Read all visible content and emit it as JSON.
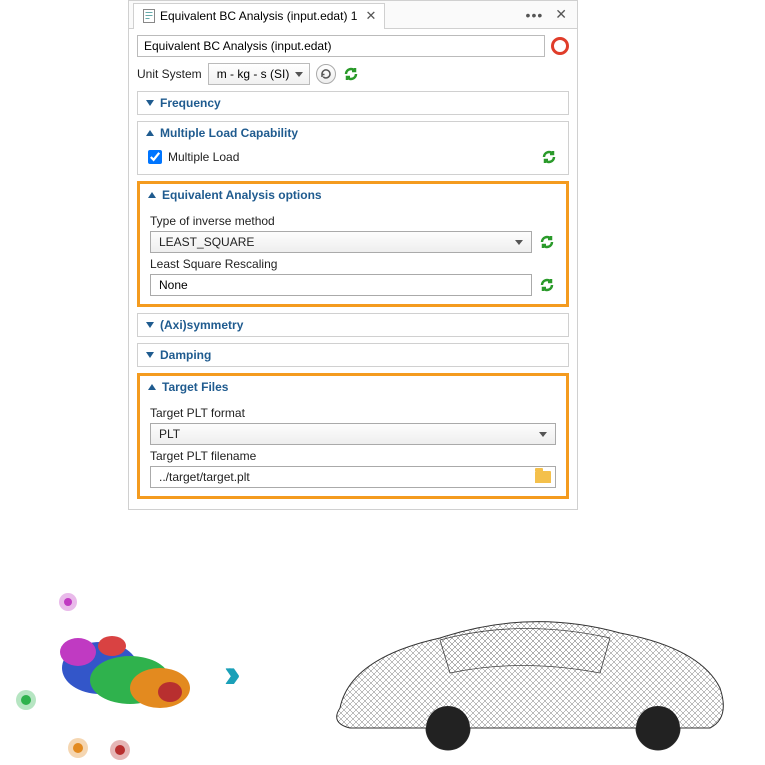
{
  "tab": {
    "title": "Equivalent BC Analysis (input.edat) 1"
  },
  "name_field": "Equivalent BC Analysis (input.edat)",
  "unit_system_label": "Unit System",
  "unit_system_value": "m - kg - s (SI)",
  "sections": {
    "frequency": {
      "title": "Frequency",
      "expanded": false
    },
    "multiple_load": {
      "title": "Multiple Load Capability",
      "expanded": true,
      "checkbox_label": "Multiple Load",
      "checked": true
    },
    "equiv_options": {
      "title": "Equivalent Analysis options",
      "expanded": true,
      "inverse_label": "Type of inverse method",
      "inverse_value": "LEAST_SQUARE",
      "rescale_label": "Least Square Rescaling",
      "rescale_value": "None"
    },
    "axisymmetry": {
      "title": "(Axi)symmetry",
      "expanded": false
    },
    "damping": {
      "title": "Damping",
      "expanded": false
    },
    "target_files": {
      "title": "Target Files",
      "expanded": true,
      "format_label": "Target PLT format",
      "format_value": "PLT",
      "filename_label": "Target PLT filename",
      "filename_value": "../target/target.plt"
    }
  }
}
